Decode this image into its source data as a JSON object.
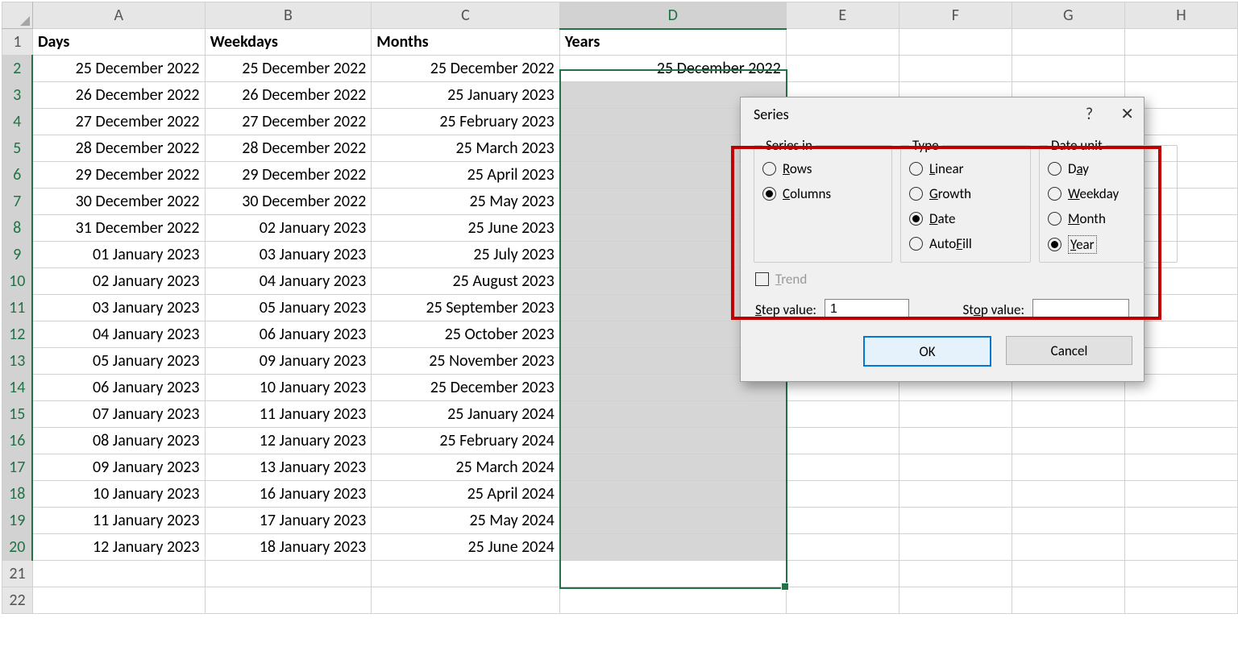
{
  "columns": [
    "A",
    "B",
    "C",
    "D",
    "E",
    "F",
    "G",
    "H"
  ],
  "row_numbers": [
    "1",
    "2",
    "3",
    "4",
    "5",
    "6",
    "7",
    "8",
    "9",
    "10",
    "11",
    "12",
    "13",
    "14",
    "15",
    "16",
    "17",
    "18",
    "19",
    "20",
    "21",
    "22"
  ],
  "headers": {
    "A": "Days",
    "B": "Weekdays",
    "C": "Months",
    "D": "Years"
  },
  "data": {
    "A": [
      "25 December 2022",
      "26 December 2022",
      "27 December 2022",
      "28 December 2022",
      "29 December 2022",
      "30 December 2022",
      "31 December 2022",
      "01 January 2023",
      "02 January 2023",
      "03 January 2023",
      "04 January 2023",
      "05 January 2023",
      "06 January 2023",
      "07 January 2023",
      "08 January 2023",
      "09 January 2023",
      "10 January 2023",
      "11 January 2023",
      "12 January 2023"
    ],
    "B": [
      "25 December 2022",
      "26 December 2022",
      "27 December 2022",
      "28 December 2022",
      "29 December 2022",
      "30 December 2022",
      "02 January 2023",
      "03 January 2023",
      "04 January 2023",
      "05 January 2023",
      "06 January 2023",
      "09 January 2023",
      "10 January 2023",
      "11 January 2023",
      "12 January 2023",
      "13 January 2023",
      "16 January 2023",
      "17 January 2023",
      "18 January 2023"
    ],
    "C": [
      "25 December 2022",
      "25 January 2023",
      "25 February 2023",
      "25 March 2023",
      "25 April 2023",
      "25 May 2023",
      "25 June 2023",
      "25 July 2023",
      "25 August 2023",
      "25 September 2023",
      "25 October 2023",
      "25 November 2023",
      "25 December 2023",
      "25 January 2024",
      "25 February 2024",
      "25 March 2024",
      "25 April 2024",
      "25 May 2024",
      "25 June 2024"
    ],
    "D": [
      "25 December 2022"
    ]
  },
  "dialog": {
    "title": "Series",
    "help_char": "?",
    "close_char": "✕",
    "groups": {
      "series_in": {
        "legend": "Series in",
        "rows": "Rows",
        "columns": "Columns",
        "selected": "columns"
      },
      "type": {
        "legend": "Type",
        "linear": "Linear",
        "growth": "Growth",
        "date": "Date",
        "autofill": "AutoFill",
        "selected": "date"
      },
      "date_unit": {
        "legend": "Date unit",
        "day": "Day",
        "weekday": "Weekday",
        "month": "Month",
        "year": "Year",
        "selected": "year"
      }
    },
    "trend_label": "Trend",
    "step_label": "Step value:",
    "step_value": "1",
    "stop_label": "Stop value:",
    "stop_value": "",
    "ok": "OK",
    "cancel": "Cancel"
  },
  "underline": {
    "rows": "R",
    "columns": "C",
    "linear": "L",
    "growth": "G",
    "date": "D",
    "autofill": "F",
    "day": "a",
    "weekday": "W",
    "month": "M",
    "year": "Y",
    "trend": "T",
    "step": "S",
    "stop": "o"
  }
}
